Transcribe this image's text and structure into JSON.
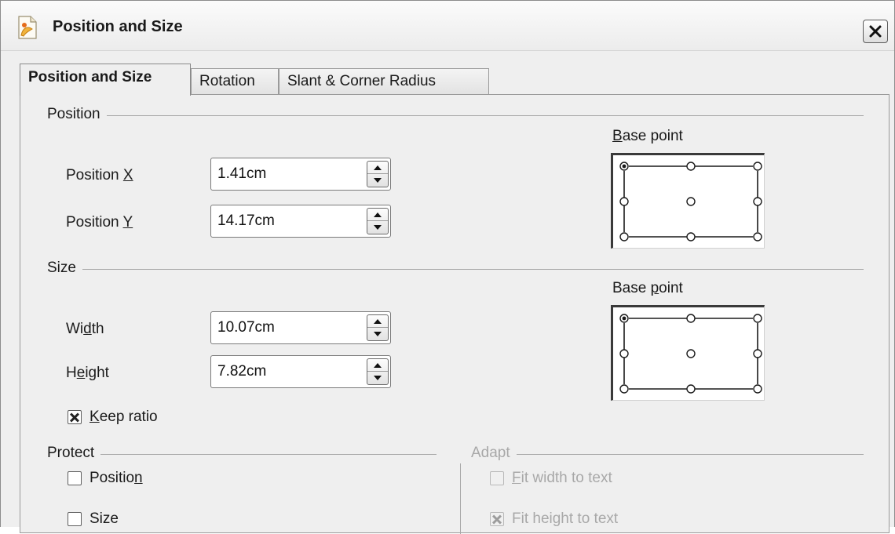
{
  "window": {
    "title": "Position and Size",
    "close_label": "×"
  },
  "tabs": [
    {
      "label": "Position and Size",
      "active": true
    },
    {
      "label": "Rotation",
      "active": false
    },
    {
      "label": "Slant & Corner Radius",
      "active": false
    }
  ],
  "position": {
    "heading": "Position",
    "x_label_pre": "Position ",
    "x_label_key": "X",
    "x_value": "1.41cm",
    "y_label_pre": "Position ",
    "y_label_key": "Y",
    "y_value": "14.17cm",
    "base_point_key": "B",
    "base_point_rest": "ase point",
    "base_point_selected": "top-left"
  },
  "size": {
    "heading": "Size",
    "width_pre": "Wi",
    "width_key": "d",
    "width_post": "th",
    "width_value": "10.07cm",
    "height_pre": "H",
    "height_key": "e",
    "height_post": "ight",
    "height_value": "7.82cm",
    "keep_ratio_key": "K",
    "keep_ratio_rest": "eep ratio",
    "keep_ratio_checked": true,
    "base_point_pre": "Base ",
    "base_point_key": "p",
    "base_point_post": "oint",
    "base_point_selected": "top-left"
  },
  "protect": {
    "heading": "Protect",
    "position_pre": "Positio",
    "position_key": "n",
    "position_checked": false,
    "size_label": "Size",
    "size_checked": false
  },
  "adapt": {
    "heading": "Adapt",
    "fit_width_key": "F",
    "fit_width_rest": "it width to text",
    "fit_width_checked": false,
    "fit_height_label": "Fit height to text",
    "fit_height_checked": true
  },
  "icons": {
    "app": "draw-app-icon",
    "close": "close-icon",
    "spin_up": "arrow-up-icon",
    "spin_down": "arrow-down-icon"
  },
  "colors": {
    "dialog_bg": "#efefef",
    "border": "#9a9a9a",
    "disabled_text": "#a8a8a8"
  }
}
